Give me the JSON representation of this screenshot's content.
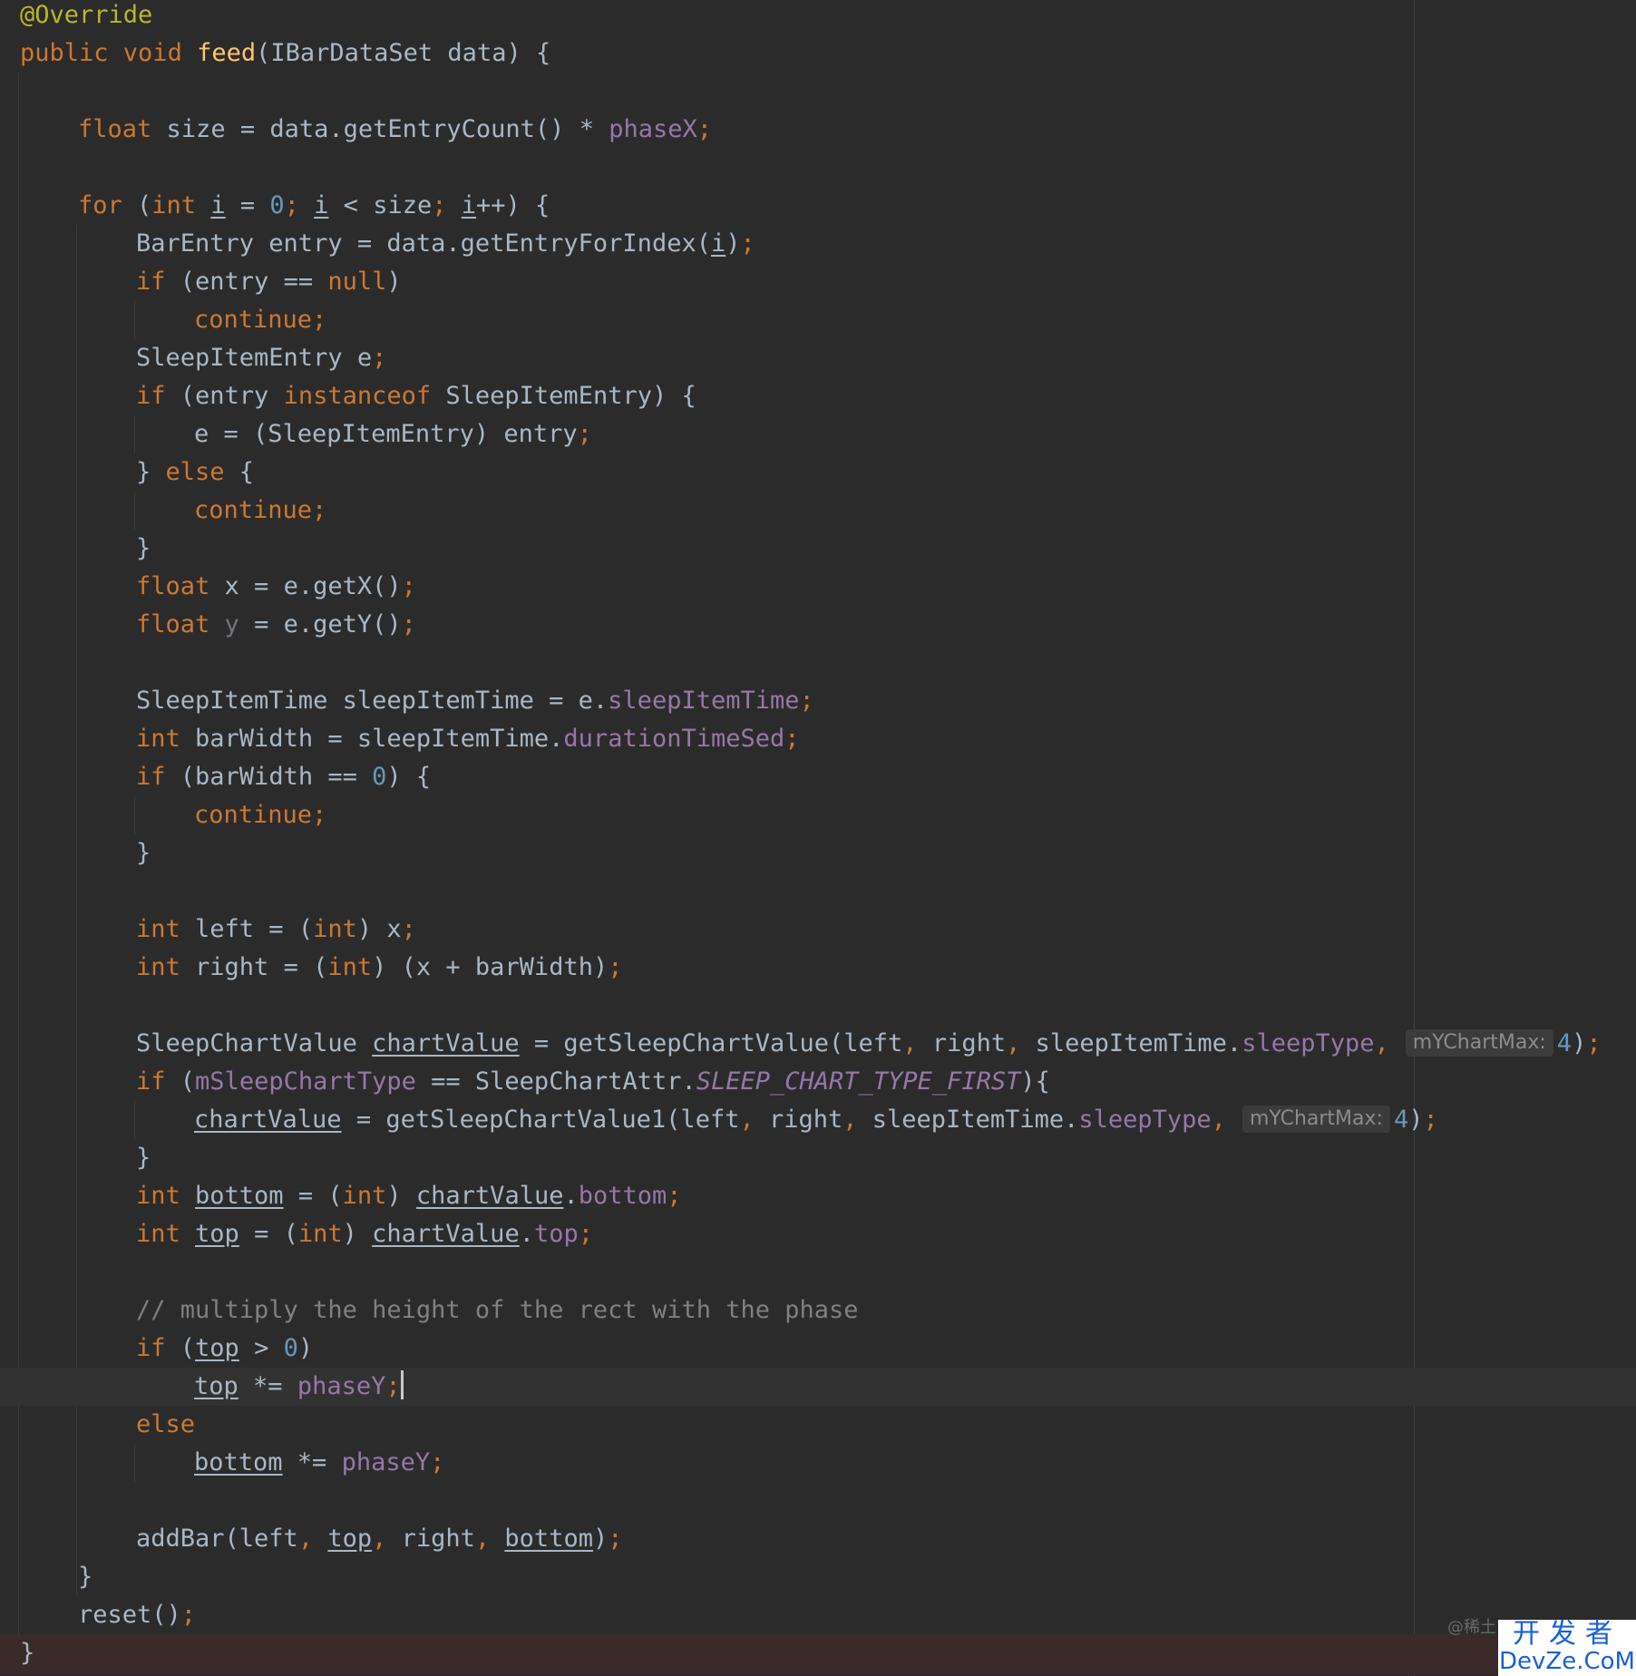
{
  "editor": {
    "language": "java",
    "theme": "Darcula",
    "caret_line": 36,
    "colors": {
      "background": "#2b2b2b",
      "keyword": "#cc7832",
      "annotation": "#bbb529",
      "method_declaration": "#ffc66d",
      "field": "#9876aa",
      "number": "#6897bb",
      "comment": "#808080",
      "text": "#a9b7c6"
    },
    "lines": [
      {
        "indent": 0,
        "tokens": [
          {
            "t": "@Override",
            "c": "ann"
          }
        ]
      },
      {
        "indent": 0,
        "tokens": [
          {
            "t": "public ",
            "c": "kw"
          },
          {
            "t": "void ",
            "c": "kw"
          },
          {
            "t": "feed",
            "c": "fn"
          },
          {
            "t": "(IBarDataSet data) {"
          }
        ]
      },
      {
        "indent": 0,
        "tokens": []
      },
      {
        "indent": 1,
        "tokens": [
          {
            "t": "float ",
            "c": "kw"
          },
          {
            "t": "size = data.getEntryCount() * "
          },
          {
            "t": "phaseX",
            "c": "fld"
          },
          {
            "t": ";",
            "c": "p"
          }
        ]
      },
      {
        "indent": 0,
        "tokens": []
      },
      {
        "indent": 1,
        "tokens": [
          {
            "t": "for ",
            "c": "kw"
          },
          {
            "t": "("
          },
          {
            "t": "int ",
            "c": "kw"
          },
          {
            "t": "i",
            "u": true
          },
          {
            "t": " = "
          },
          {
            "t": "0",
            "c": "num"
          },
          {
            "t": "; ",
            "c": "p"
          },
          {
            "t": "i",
            "u": true
          },
          {
            "t": " < size"
          },
          {
            "t": "; ",
            "c": "p"
          },
          {
            "t": "i",
            "u": true
          },
          {
            "t": "++) {"
          }
        ]
      },
      {
        "indent": 2,
        "tokens": [
          {
            "t": "BarEntry entry = data.getEntryForIndex("
          },
          {
            "t": "i",
            "u": true
          },
          {
            "t": ")"
          },
          {
            "t": ";",
            "c": "p"
          }
        ]
      },
      {
        "indent": 2,
        "tokens": [
          {
            "t": "if ",
            "c": "kw"
          },
          {
            "t": "(entry == "
          },
          {
            "t": "null",
            "c": "kw"
          },
          {
            "t": ")"
          }
        ]
      },
      {
        "indent": 3,
        "tokens": [
          {
            "t": "continue",
            "c": "kw"
          },
          {
            "t": ";",
            "c": "p"
          }
        ]
      },
      {
        "indent": 2,
        "tokens": [
          {
            "t": "SleepItemEntry e"
          },
          {
            "t": ";",
            "c": "p"
          }
        ]
      },
      {
        "indent": 2,
        "tokens": [
          {
            "t": "if ",
            "c": "kw"
          },
          {
            "t": "(entry "
          },
          {
            "t": "instanceof ",
            "c": "kw"
          },
          {
            "t": "SleepItemEntry) {"
          }
        ]
      },
      {
        "indent": 3,
        "tokens": [
          {
            "t": "e = (SleepItemEntry) entry"
          },
          {
            "t": ";",
            "c": "p"
          }
        ]
      },
      {
        "indent": 2,
        "tokens": [
          {
            "t": "} "
          },
          {
            "t": "else ",
            "c": "kw"
          },
          {
            "t": "{"
          }
        ]
      },
      {
        "indent": 3,
        "tokens": [
          {
            "t": "continue",
            "c": "kw"
          },
          {
            "t": ";",
            "c": "p"
          }
        ]
      },
      {
        "indent": 2,
        "tokens": [
          {
            "t": "}"
          }
        ]
      },
      {
        "indent": 2,
        "tokens": [
          {
            "t": "float ",
            "c": "kw"
          },
          {
            "t": "x = e.getX()"
          },
          {
            "t": ";",
            "c": "p"
          }
        ]
      },
      {
        "indent": 2,
        "tokens": [
          {
            "t": "float ",
            "c": "kw"
          },
          {
            "t": "y",
            "c": "dim"
          },
          {
            "t": " = e.getY()"
          },
          {
            "t": ";",
            "c": "p"
          }
        ]
      },
      {
        "indent": 0,
        "tokens": []
      },
      {
        "indent": 2,
        "tokens": [
          {
            "t": "SleepItemTime sleepItemTime = e."
          },
          {
            "t": "sleepItemTime",
            "c": "fld"
          },
          {
            "t": ";",
            "c": "p"
          }
        ]
      },
      {
        "indent": 2,
        "tokens": [
          {
            "t": "int ",
            "c": "kw"
          },
          {
            "t": "barWidth = sleepItemTime."
          },
          {
            "t": "durationTimeSed",
            "c": "fld"
          },
          {
            "t": ";",
            "c": "p"
          }
        ]
      },
      {
        "indent": 2,
        "tokens": [
          {
            "t": "if ",
            "c": "kw"
          },
          {
            "t": "(barWidth == "
          },
          {
            "t": "0",
            "c": "num"
          },
          {
            "t": ") {"
          }
        ]
      },
      {
        "indent": 3,
        "tokens": [
          {
            "t": "continue",
            "c": "kw"
          },
          {
            "t": ";",
            "c": "p"
          }
        ]
      },
      {
        "indent": 2,
        "tokens": [
          {
            "t": "}"
          }
        ]
      },
      {
        "indent": 0,
        "tokens": []
      },
      {
        "indent": 2,
        "tokens": [
          {
            "t": "int ",
            "c": "kw"
          },
          {
            "t": "left = ("
          },
          {
            "t": "int",
            "c": "kw"
          },
          {
            "t": ") x"
          },
          {
            "t": ";",
            "c": "p"
          }
        ]
      },
      {
        "indent": 2,
        "tokens": [
          {
            "t": "int ",
            "c": "kw"
          },
          {
            "t": "right = ("
          },
          {
            "t": "int",
            "c": "kw"
          },
          {
            "t": ") (x + barWidth)"
          },
          {
            "t": ";",
            "c": "p"
          }
        ]
      },
      {
        "indent": 0,
        "tokens": []
      },
      {
        "indent": 2,
        "tokens": [
          {
            "t": "SleepChartValue "
          },
          {
            "t": "chartValue",
            "u": true
          },
          {
            "t": " = getSleepChartValue(left"
          },
          {
            "t": ", ",
            "c": "p"
          },
          {
            "t": "right"
          },
          {
            "t": ", ",
            "c": "p"
          },
          {
            "t": "sleepItemTime."
          },
          {
            "t": "sleepType",
            "c": "fld"
          },
          {
            "t": ",",
            "c": "p"
          },
          {
            "t": "mYChartMax:",
            "hint": true
          },
          {
            "t": "4",
            "c": "num"
          },
          {
            "t": ")"
          },
          {
            "t": ";",
            "c": "p"
          }
        ]
      },
      {
        "indent": 2,
        "tokens": [
          {
            "t": "if ",
            "c": "kw"
          },
          {
            "t": "("
          },
          {
            "t": "mSleepChartType",
            "c": "fld"
          },
          {
            "t": " == SleepChartAttr."
          },
          {
            "t": "SLEEP_CHART_TYPE_FIRST",
            "c": "const"
          },
          {
            "t": "){"
          }
        ]
      },
      {
        "indent": 3,
        "tokens": [
          {
            "t": "chartValue",
            "u": true
          },
          {
            "t": " = getSleepChartValue1(left"
          },
          {
            "t": ", ",
            "c": "p"
          },
          {
            "t": "right"
          },
          {
            "t": ", ",
            "c": "p"
          },
          {
            "t": "sleepItemTime."
          },
          {
            "t": "sleepType",
            "c": "fld"
          },
          {
            "t": ",",
            "c": "p"
          },
          {
            "t": "mYChartMax:",
            "hint": true
          },
          {
            "t": "4",
            "c": "num"
          },
          {
            "t": ")"
          },
          {
            "t": ";",
            "c": "p"
          }
        ]
      },
      {
        "indent": 2,
        "tokens": [
          {
            "t": "}"
          }
        ]
      },
      {
        "indent": 2,
        "tokens": [
          {
            "t": "int ",
            "c": "kw"
          },
          {
            "t": "bottom",
            "u": true
          },
          {
            "t": " = ("
          },
          {
            "t": "int",
            "c": "kw"
          },
          {
            "t": ") "
          },
          {
            "t": "chartValue",
            "u": true
          },
          {
            "t": "."
          },
          {
            "t": "bottom",
            "c": "fld"
          },
          {
            "t": ";",
            "c": "p"
          }
        ]
      },
      {
        "indent": 2,
        "tokens": [
          {
            "t": "int ",
            "c": "kw"
          },
          {
            "t": "top",
            "u": true
          },
          {
            "t": " = ("
          },
          {
            "t": "int",
            "c": "kw"
          },
          {
            "t": ") "
          },
          {
            "t": "chartValue",
            "u": true
          },
          {
            "t": "."
          },
          {
            "t": "top",
            "c": "fld"
          },
          {
            "t": ";",
            "c": "p"
          }
        ]
      },
      {
        "indent": 0,
        "tokens": []
      },
      {
        "indent": 2,
        "tokens": [
          {
            "t": "// multiply the height of the rect with the phase",
            "c": "cm"
          }
        ]
      },
      {
        "indent": 2,
        "tokens": [
          {
            "t": "if ",
            "c": "kw"
          },
          {
            "t": "("
          },
          {
            "t": "top",
            "u": true
          },
          {
            "t": " > "
          },
          {
            "t": "0",
            "c": "num"
          },
          {
            "t": ")"
          }
        ]
      },
      {
        "indent": 3,
        "tokens": [
          {
            "t": "top",
            "u": true
          },
          {
            "t": " *= "
          },
          {
            "t": "phaseY",
            "c": "fld"
          },
          {
            "t": ";",
            "c": "p"
          }
        ]
      },
      {
        "indent": 2,
        "tokens": [
          {
            "t": "else",
            "c": "kw"
          }
        ]
      },
      {
        "indent": 3,
        "tokens": [
          {
            "t": "bottom",
            "u": true
          },
          {
            "t": " *= "
          },
          {
            "t": "phaseY",
            "c": "fld"
          },
          {
            "t": ";",
            "c": "p"
          }
        ]
      },
      {
        "indent": 0,
        "tokens": []
      },
      {
        "indent": 2,
        "tokens": [
          {
            "t": "addBar(left"
          },
          {
            "t": ", ",
            "c": "p"
          },
          {
            "t": "top",
            "u": true
          },
          {
            "t": ", ",
            "c": "p"
          },
          {
            "t": "right"
          },
          {
            "t": ", ",
            "c": "p"
          },
          {
            "t": "bottom",
            "u": true
          },
          {
            "t": ")"
          },
          {
            "t": ";",
            "c": "p"
          }
        ]
      },
      {
        "indent": 1,
        "tokens": [
          {
            "t": "}"
          }
        ]
      },
      {
        "indent": 1,
        "tokens": [
          {
            "t": "reset()"
          },
          {
            "t": ";",
            "c": "p"
          }
        ]
      },
      {
        "indent": 0,
        "tokens": [
          {
            "t": "}"
          }
        ]
      }
    ]
  },
  "watermark": {
    "juejin": "@稀土",
    "top": "开发者",
    "bottom": "DevZe.CoM"
  }
}
